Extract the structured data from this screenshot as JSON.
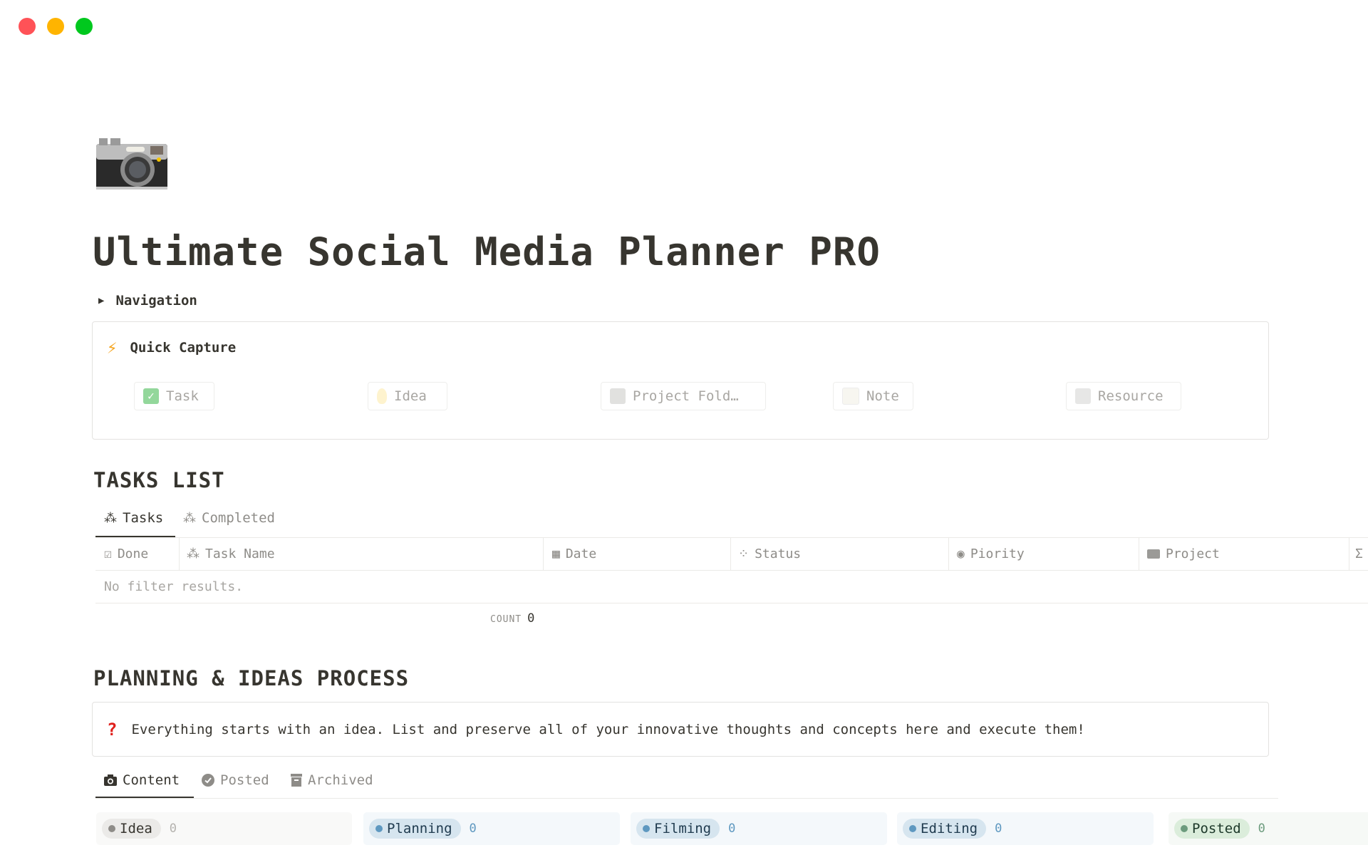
{
  "window": {
    "controls": {
      "close_color": "#ff5257",
      "minimize_color": "#ffb400",
      "maximize_color": "#00c81e"
    }
  },
  "page": {
    "icon": "camera-icon",
    "title": "Ultimate Social Media Planner PRO",
    "navigation_toggle": "Navigation"
  },
  "quick_capture": {
    "icon": "lightning-icon",
    "title": "Quick Capture",
    "buttons": [
      {
        "icon": "check-mark-button-icon",
        "label": "Task"
      },
      {
        "icon": "light-bulb-icon",
        "label": "Idea"
      },
      {
        "icon": "file-folder-icon",
        "label": "Project Fold…"
      },
      {
        "icon": "memo-icon",
        "label": "Note"
      },
      {
        "icon": "newspaper-icon",
        "label": "Resource"
      }
    ]
  },
  "tasks_list": {
    "heading": "TASKS LIST",
    "tabs": [
      {
        "icon": "loading-cursor-icon",
        "label": "Tasks",
        "active": true
      },
      {
        "icon": "loading-cursor-icon",
        "label": "Completed",
        "active": false
      }
    ],
    "columns": [
      {
        "icon": "checkbox-icon",
        "label": "Done"
      },
      {
        "icon": "loading-cursor-icon",
        "label": "Task Name"
      },
      {
        "icon": "calendar-icon",
        "label": "Date"
      },
      {
        "icon": "loading-icon",
        "label": "Status"
      },
      {
        "icon": "circle-chevron-down-icon",
        "label": "Piority"
      },
      {
        "icon": "folder-icon",
        "label": "Project"
      },
      {
        "icon": "sigma-icon",
        "label": "Σ"
      }
    ],
    "empty_text": "No filter results.",
    "count_label": "COUNT",
    "count_value": "0"
  },
  "planning": {
    "heading": "PLANNING & IDEAS PROCESS",
    "callout_icon": "question-mark-icon",
    "callout_text": "Everything starts with an idea. List and preserve all of your innovative thoughts and concepts here and execute them!",
    "tabs": [
      {
        "icon": "camera-icon",
        "label": "Content",
        "active": true
      },
      {
        "icon": "check-circle-icon",
        "label": "Posted",
        "active": false
      },
      {
        "icon": "archive-icon",
        "label": "Archived",
        "active": false
      }
    ],
    "board_columns": [
      {
        "label": "Idea",
        "count": "0",
        "bg": "#f9f9f8",
        "pill": "#ebeae8",
        "dot": "#8e8c88",
        "count_color": "#b4b2ae",
        "text": "#37352f"
      },
      {
        "label": "Planning",
        "count": "0",
        "bg": "#f4f8fb",
        "pill": "#d6e5ef",
        "dot": "#5e98c0",
        "count_color": "#5e98c0",
        "text": "#1f3a4e"
      },
      {
        "label": "Filming",
        "count": "0",
        "bg": "#f4f8fb",
        "pill": "#d6e5ef",
        "dot": "#5e98c0",
        "count_color": "#5e98c0",
        "text": "#1f3a4e"
      },
      {
        "label": "Editing",
        "count": "0",
        "bg": "#f4f8fb",
        "pill": "#d6e5ef",
        "dot": "#5e98c0",
        "count_color": "#5e98c0",
        "text": "#1f3a4e"
      },
      {
        "label": "Posted",
        "count": "0",
        "bg": "#f6f9f6",
        "pill": "#dbeddb",
        "dot": "#6c9b7d",
        "count_color": "#6c9b7d",
        "text": "#1c3829"
      }
    ]
  }
}
